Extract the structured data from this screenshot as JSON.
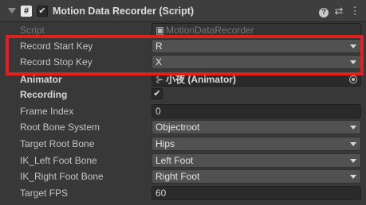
{
  "header": {
    "title": "Motion Data Recorder (Script)",
    "script_icon": "#",
    "enabled_mark": "✔",
    "help_glyph": "?",
    "settings_glyph": "⇄",
    "more_glyph": "⋮"
  },
  "script_row": {
    "label": "Script",
    "value": "MotionDataRecorder"
  },
  "fields": {
    "record_start_key": {
      "label": "Record Start Key",
      "value": "R"
    },
    "record_stop_key": {
      "label": "Record Stop Key",
      "value": "X"
    },
    "animator": {
      "label": "Animator",
      "value": "小夜 (Animator)"
    },
    "recording": {
      "label": "Recording",
      "check": "✔"
    },
    "frame_index": {
      "label": "Frame Index",
      "value": "0"
    },
    "root_bone_system": {
      "label": "Root Bone System",
      "value": "Objectroot"
    },
    "target_root_bone": {
      "label": "Target Root Bone",
      "value": "Hips"
    },
    "ik_left_foot_bone": {
      "label": "IK_Left Foot Bone",
      "value": "Left Foot"
    },
    "ik_right_foot_bone": {
      "label": "IK_Right Foot Bone",
      "value": "Right Foot"
    },
    "target_fps": {
      "label": "Target FPS",
      "value": "60"
    }
  },
  "colors": {
    "highlight": "#e32020",
    "background": "#383838"
  }
}
